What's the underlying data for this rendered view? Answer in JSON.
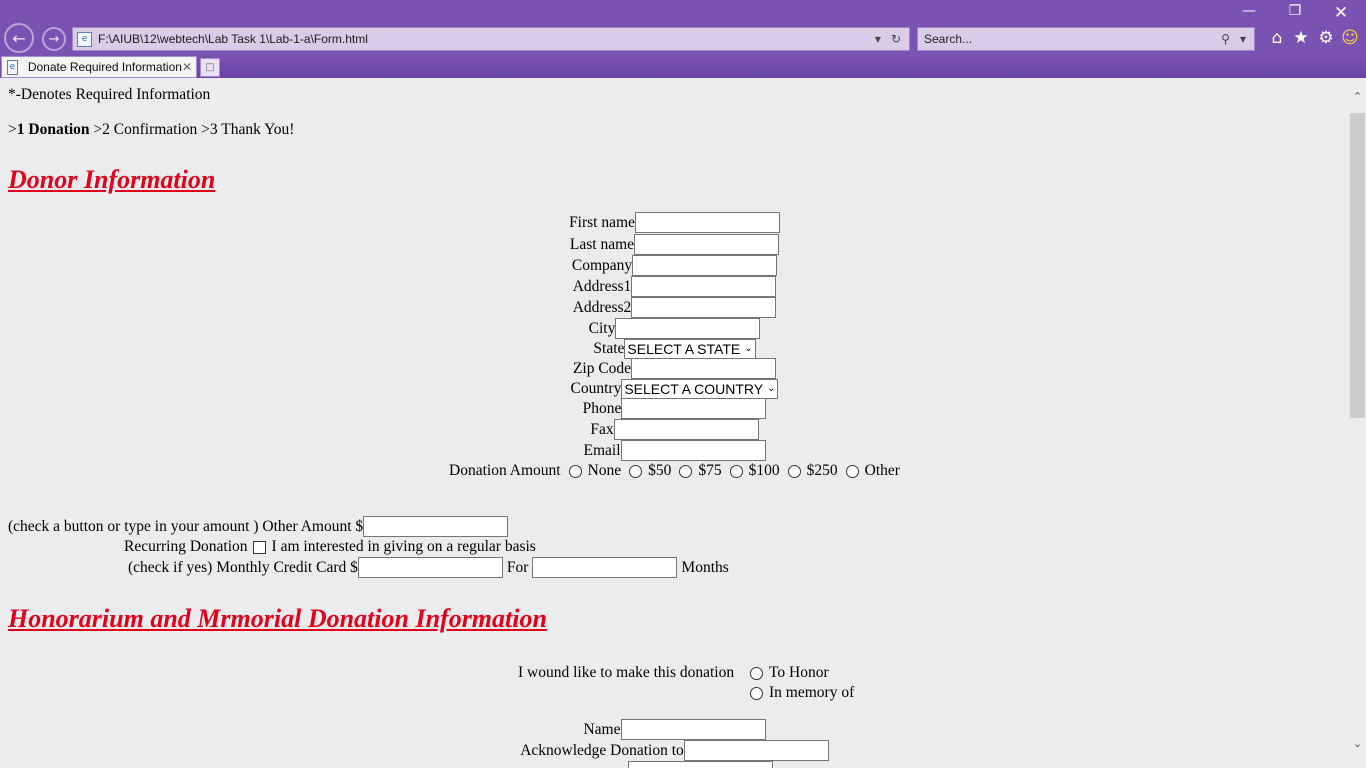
{
  "browser": {
    "url": "F:\\AIUB\\12\\webtech\\Lab Task 1\\Lab-1-a\\Form.html",
    "search_placeholder": "Search...",
    "tab_title": "Donate Required Information",
    "icons": {
      "back": "back-arrow-icon",
      "forward": "forward-arrow-icon",
      "refresh": "refresh-icon",
      "dropdown": "chevron-down-icon",
      "search": "search-icon",
      "home": "home-icon",
      "favorites": "star-icon",
      "tools": "gear-icon",
      "feedback": "smiley-icon"
    },
    "accent_color": "#7a52b2"
  },
  "page": {
    "required_note": "*-Denotes Required Information",
    "steps": {
      "prefix1": ">",
      "step1": "1 Donation",
      "rest": " >2 Confirmation >3 Thank You!"
    },
    "donor_heading": "Donor Information",
    "fields": {
      "first_name": "First name",
      "last_name": "Last name",
      "company": "Company",
      "address1": "Address1",
      "address2": "Address2",
      "city": "City",
      "state": "State",
      "state_selected": "SELECT A STATE",
      "zip": "Zip Code",
      "country": "Country",
      "country_selected": "SELECT A COUNTRY",
      "phone": "Phone",
      "fax": "Fax",
      "email": "Email"
    },
    "donation_amount": {
      "label": "Donation Amount",
      "options": [
        "None",
        "$50",
        "$75",
        "$100",
        "$250",
        "Other"
      ]
    },
    "other_amount_label": "(check a button or type in your amount ) Other Amount $",
    "recurring": {
      "label": "Recurring Donation",
      "checkbox_text": "I am interested in giving on a regular basis"
    },
    "monthly": {
      "label": "(check if yes) Monthly Credit Card $",
      "for_label": "For",
      "months_label": "Months"
    },
    "honorarium_heading": "Honorarium and Mrmorial Donation Information",
    "honor": {
      "label": "I wound like to make this donation",
      "option1": "To Honor",
      "option2": "In memory of"
    },
    "name_label": "Name",
    "acknowledge_label": "Acknowledge Donation to"
  }
}
